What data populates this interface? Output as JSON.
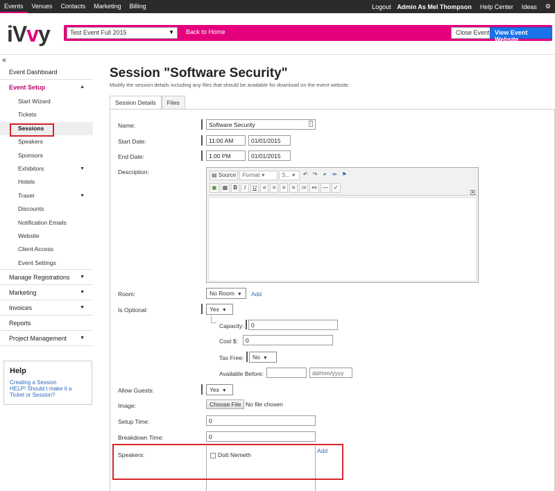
{
  "topnav": {
    "items": [
      "Events",
      "Venues",
      "Contacts",
      "Marketing",
      "Billing"
    ],
    "logout": "Logout",
    "user": "Admin As Mel Thompson",
    "help_center": "Help Center",
    "ideas": "Ideas"
  },
  "header": {
    "logo_left": "iV",
    "logo_mid": "v",
    "logo_right": "y",
    "event_select": "Test Event Full 2015",
    "back_home": "Back to Home",
    "close_event": "Close Event",
    "view_website": "View Event Website"
  },
  "sidebar": {
    "collapse": "«",
    "dashboard": "Event Dashboard",
    "event_setup": "Event Setup",
    "sub": [
      "Start Wizard",
      "Tickets",
      "Sessions",
      "Speakers",
      "Sponsors",
      "Exhibitors",
      "Hotels",
      "Travel",
      "Discounts",
      "Notification Emails",
      "Website",
      "Client Access",
      "Event Settings"
    ],
    "manage_registrations": "Manage Registrations",
    "marketing": "Marketing",
    "invoices": "Invoices",
    "reports": "Reports",
    "project_management": "Project Management"
  },
  "help": {
    "title": "Help",
    "link1": "Creating a Session",
    "link2": "HELP! Should I make it a Ticket or Session?"
  },
  "page": {
    "title": "Session \"Software Security\"",
    "subtitle": "Modify the session details including any files that should be available for download on the event website.",
    "tabs": [
      "Session Details",
      "Files"
    ]
  },
  "form": {
    "name_label": "Name:",
    "name_value": "Software Security",
    "start_label": "Start Date:",
    "start_time": "11:00 AM",
    "start_date": "01/01/2015",
    "end_label": "End Date:",
    "end_time": "1:00 PM",
    "end_date": "01/01/2015",
    "description_label": "Description:",
    "editor": {
      "source": "Source",
      "format": "Format",
      "style": "S...",
      "bold": "B",
      "italic": "I",
      "underline": "U"
    },
    "room_label": "Room:",
    "room_value": "No Room",
    "room_add": "Add",
    "optional_label": "Is Optional:",
    "optional_value": "Yes",
    "capacity_label": "Capacity:",
    "capacity_value": "0",
    "cost_label": "Cost $:",
    "cost_value": "0",
    "taxfree_label": "Tax Free:",
    "taxfree_value": "No",
    "available_label": "Available Before:",
    "available_value": "",
    "available_date_placeholder": "dd/mm/yyyy",
    "guests_label": "Allow Guests:",
    "guests_value": "Yes",
    "image_label": "Image:",
    "choose_file": "Choose File",
    "no_file": "No file chosen",
    "setup_label": "Setup Time:",
    "setup_value": "0",
    "breakdown_label": "Breakdown Time:",
    "breakdown_value": "0",
    "speakers_label": "Speakers:",
    "speaker1": "Dott Nemeth",
    "speakers_add": "Add"
  },
  "colors": {
    "brand_pink": "#e5007e",
    "primary_blue": "#1a73e8",
    "highlight_red": "#d6242a",
    "topnav_bg": "#2b2b2b"
  }
}
